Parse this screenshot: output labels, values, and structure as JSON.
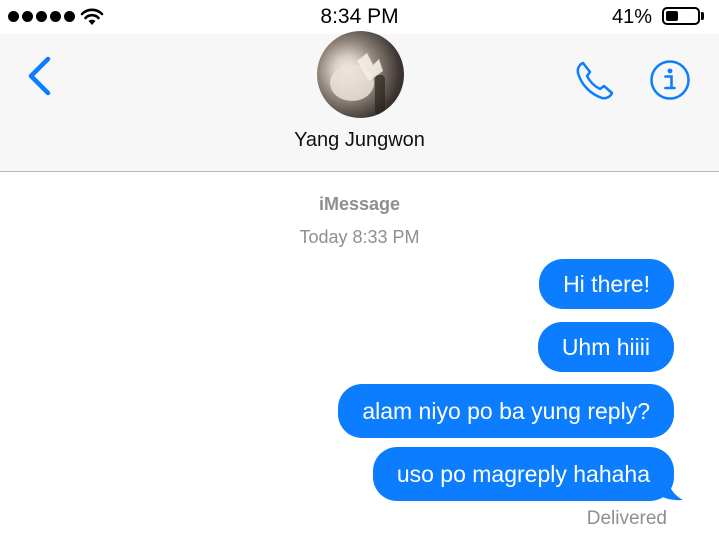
{
  "status_bar": {
    "time": "8:34 PM",
    "battery_percent": "41%",
    "battery_level": 0.41,
    "signal_bars": 5,
    "wifi_icon": "wifi-icon"
  },
  "header": {
    "contact_name": "Yang Jungwon",
    "back_icon": "chevron-left-icon",
    "call_icon": "phone-icon",
    "info_icon": "info-icon"
  },
  "conversation": {
    "service": "iMessage",
    "timestamp": "Today 8:33 PM",
    "messages": [
      {
        "text": "Hi there!",
        "sender": "me"
      },
      {
        "text": "Uhm hiiii",
        "sender": "me"
      },
      {
        "text": "alam niyo po ba yung reply?",
        "sender": "me"
      },
      {
        "text": "uso po magreply hahaha",
        "sender": "me"
      }
    ],
    "status": "Delivered"
  },
  "colors": {
    "accent": "#0b7dfe",
    "header_bg": "#f7f7f7",
    "meta_text": "#8e8e93"
  }
}
